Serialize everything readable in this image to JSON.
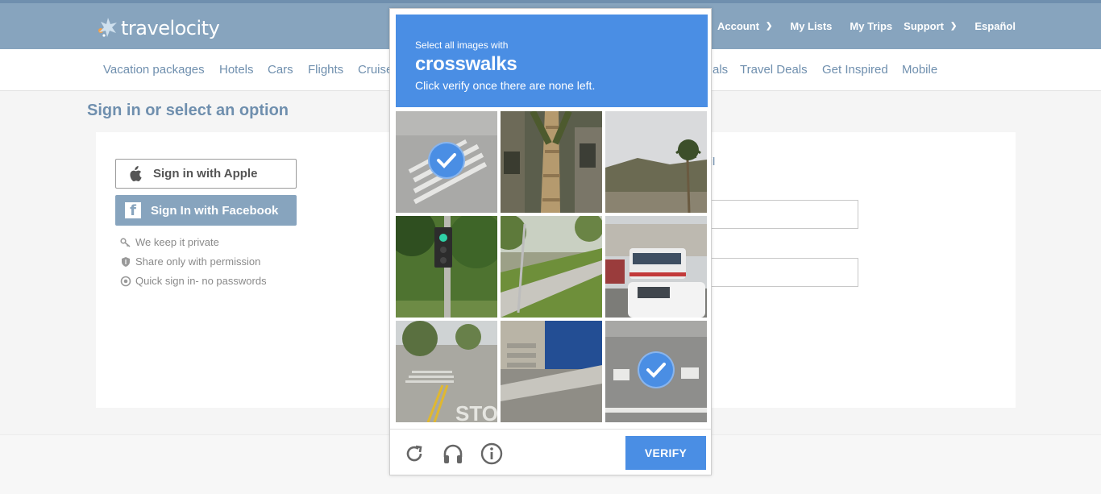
{
  "brand": {
    "name": "travelocity"
  },
  "topnav": {
    "account": "Account",
    "my_lists": "My Lists",
    "my_trips": "My Trips",
    "support": "Support",
    "language": "Español"
  },
  "subnav": {
    "vacation_packages": "Vacation packages",
    "hotels": "Hotels",
    "cars": "Cars",
    "flights": "Flights",
    "cruises_partial": "Cruise",
    "deals_partial": "als",
    "travel_deals": "Travel Deals",
    "get_inspired": "Get Inspired",
    "mobile": "Mobile"
  },
  "page": {
    "title": "Sign in or select an option",
    "apple_button": "Sign in with Apple",
    "facebook_button": "Sign In with Facebook",
    "perks": [
      "We keep it private",
      "Share only with permission",
      "Quick sign in- no passwords"
    ],
    "email_partial": "il"
  },
  "captcha": {
    "instruction": "Select all images with",
    "target": "crosswalks",
    "subtext": "Click verify once there are none left.",
    "verify_label": "VERIFY",
    "tiles": [
      {
        "scene": "crosswalk-road",
        "selected": true
      },
      {
        "scene": "palm-trunk-building",
        "selected": false
      },
      {
        "scene": "palm-hills",
        "selected": false
      },
      {
        "scene": "traffic-light-trees",
        "selected": false
      },
      {
        "scene": "sidewalk-grass",
        "selected": false
      },
      {
        "scene": "bus-van-street",
        "selected": false
      },
      {
        "scene": "intersection-stop",
        "selected": false
      },
      {
        "scene": "steps-sidewalk",
        "selected": false
      },
      {
        "scene": "crosswalk-road",
        "selected": true
      }
    ]
  },
  "colors": {
    "header": "#87a4be",
    "accent_link": "#6f8fae",
    "captcha_blue": "#4a8ee4"
  }
}
